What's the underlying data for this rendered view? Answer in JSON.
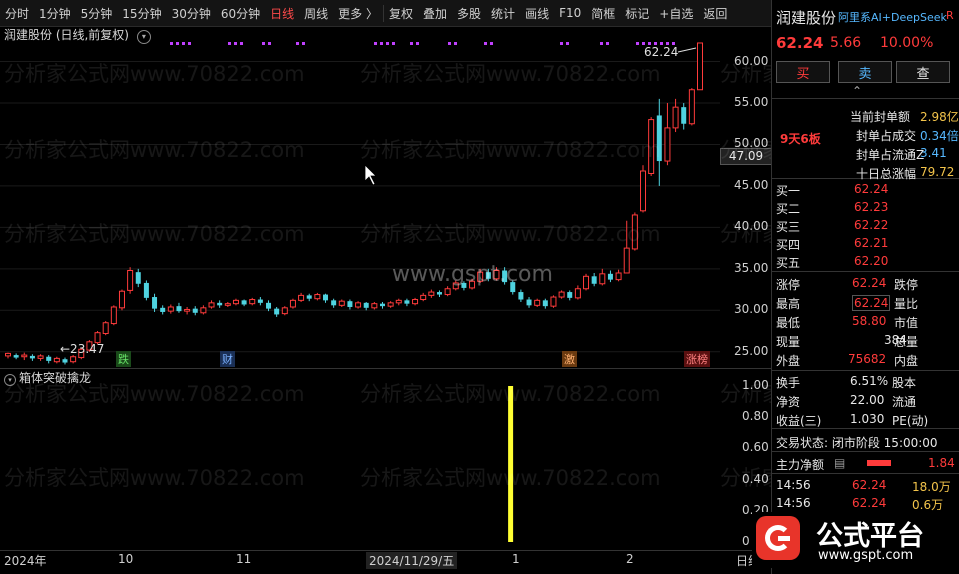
{
  "toolbar": {
    "items": [
      "分时",
      "1分钟",
      "5分钟",
      "15分钟",
      "30分钟",
      "60分钟",
      "日线",
      "周线",
      "更多 〉",
      "复权",
      "叠加",
      "多股",
      "统计",
      "画线",
      "F10",
      "简框",
      "标记",
      "+自选",
      "返回"
    ],
    "active": "日线"
  },
  "chart": {
    "title": "润建股份 (日线,前复权)",
    "watermark": "分析家公式网www.70822.com",
    "center_watermark": "www.gspt.com",
    "price_axis": [
      "60.00",
      "55.00",
      "50.00",
      "45.00",
      "40.00",
      "35.00",
      "30.00",
      "25.00"
    ],
    "current_price_tag": "47.09",
    "high_label": "62.24",
    "low_label": "23.47",
    "event_tags": [
      "跌",
      "财",
      "激",
      "涨榜"
    ],
    "date_axis": [
      "2024年",
      "10",
      "11",
      "2024/11/29/五",
      "1",
      "2",
      "日线"
    ]
  },
  "indicator": {
    "title": "箱体突破擒龙",
    "axis": [
      "1.00",
      "0.80",
      "0.60",
      "0.40",
      "0.20",
      "0"
    ],
    "signal_value": 1.0
  },
  "panel": {
    "name": "润建股份",
    "tags": "阿里系AI+DeepSeek",
    "tag_r": "R",
    "price": "62.24",
    "change": "5.66",
    "change_pct": "10.00%",
    "buttons": [
      "买",
      "卖",
      "查"
    ],
    "streak": "9天6板",
    "seal_info": [
      {
        "label": "当前封单额",
        "value": "2.98亿"
      },
      {
        "label": "封单占成交",
        "value": "0.34倍"
      },
      {
        "label": "封单占流通Z",
        "value": "3.41"
      },
      {
        "label": "十日总涨幅",
        "value": "79.72"
      }
    ],
    "bids": [
      {
        "label": "买一",
        "price": "62.24"
      },
      {
        "label": "买二",
        "price": "62.23"
      },
      {
        "label": "买三",
        "price": "62.22"
      },
      {
        "label": "买四",
        "price": "62.21"
      },
      {
        "label": "买五",
        "price": "62.20"
      }
    ],
    "stats": [
      {
        "l1": "涨停",
        "v1": "62.24",
        "l2": "跌停"
      },
      {
        "l1": "最高",
        "v1": "62.24",
        "l2": "量比"
      },
      {
        "l1": "最低",
        "v1": "58.80",
        "l2": "市值"
      },
      {
        "l1": "现量",
        "v1": "384",
        "l2": "总量"
      },
      {
        "l1": "外盘",
        "v1": "75682",
        "l2": "内盘"
      }
    ],
    "stats2": [
      {
        "l1": "换手",
        "v1": "6.51%",
        "l2": "股本"
      },
      {
        "l1": "净资",
        "v1": "22.00",
        "l2": "流通"
      },
      {
        "l1": "收益(三)",
        "v1": "1.030",
        "l2": "PE(动)"
      }
    ],
    "trade_status": "交易状态: 闭市阶段 15:00:00",
    "main_flow_label": "主力净额",
    "main_flow_value": "1.84",
    "ticks": [
      {
        "time": "14:56",
        "price": "62.24",
        "vol": "18.0万"
      },
      {
        "time": "14:56",
        "price": "62.24",
        "vol": "0.6万"
      }
    ]
  },
  "logo": {
    "title": "公式平台",
    "url": "www.gspt.com"
  },
  "colors": {
    "up": "#ff3b3b",
    "down": "#4fd3e0",
    "signal": "#ffff33",
    "dot": "#c040ff"
  },
  "candles": [
    [
      24.5,
      24.8,
      24.2,
      24.9
    ],
    [
      24.6,
      24.3,
      24.1,
      24.8
    ],
    [
      24.4,
      24.6,
      24.0,
      24.9
    ],
    [
      24.5,
      24.2,
      23.9,
      24.7
    ],
    [
      24.2,
      24.5,
      23.9,
      24.7
    ],
    [
      24.4,
      23.9,
      23.6,
      24.6
    ],
    [
      23.8,
      24.2,
      23.6,
      24.4
    ],
    [
      24.1,
      23.7,
      23.47,
      24.3
    ],
    [
      23.8,
      24.4,
      23.6,
      24.6
    ],
    [
      24.3,
      25.3,
      24.1,
      25.5
    ],
    [
      25.2,
      26.2,
      25.0,
      26.4
    ],
    [
      26.1,
      27.3,
      25.9,
      27.5
    ],
    [
      27.2,
      28.5,
      27.0,
      28.7
    ],
    [
      28.4,
      30.4,
      28.2,
      30.6
    ],
    [
      30.3,
      32.3,
      30.0,
      32.5
    ],
    [
      32.4,
      34.8,
      32.0,
      35.2
    ],
    [
      34.6,
      33.2,
      32.8,
      35.0
    ],
    [
      33.3,
      31.5,
      31.2,
      33.6
    ],
    [
      31.6,
      30.2,
      29.8,
      32.0
    ],
    [
      30.3,
      29.8,
      29.5,
      30.6
    ],
    [
      29.9,
      30.4,
      29.6,
      30.7
    ],
    [
      30.5,
      29.9,
      29.7,
      30.9
    ],
    [
      29.9,
      30.1,
      29.5,
      30.4
    ],
    [
      30.2,
      29.7,
      29.4,
      30.5
    ],
    [
      29.7,
      30.3,
      29.5,
      30.6
    ],
    [
      30.4,
      30.9,
      30.2,
      31.2
    ],
    [
      30.9,
      30.6,
      30.3,
      31.2
    ],
    [
      30.6,
      30.8,
      30.4,
      31.0
    ],
    [
      30.8,
      31.2,
      30.6,
      31.4
    ],
    [
      31.2,
      30.7,
      30.5,
      31.3
    ],
    [
      30.8,
      31.3,
      30.6,
      31.5
    ],
    [
      31.3,
      30.9,
      30.6,
      31.6
    ],
    [
      30.9,
      30.2,
      29.9,
      31.2
    ],
    [
      30.2,
      29.5,
      29.2,
      30.4
    ],
    [
      29.6,
      30.3,
      29.4,
      30.5
    ],
    [
      30.4,
      31.2,
      30.2,
      31.4
    ],
    [
      31.2,
      31.8,
      31.0,
      32.1
    ],
    [
      31.8,
      31.4,
      31.1,
      32.0
    ],
    [
      31.4,
      31.9,
      31.2,
      32.1
    ],
    [
      31.9,
      31.2,
      30.9,
      32.0
    ],
    [
      31.2,
      30.6,
      30.3,
      31.4
    ],
    [
      30.6,
      31.1,
      30.4,
      31.3
    ],
    [
      31.1,
      30.4,
      30.1,
      31.3
    ],
    [
      30.4,
      30.9,
      30.2,
      31.1
    ],
    [
      30.9,
      30.3,
      30.0,
      31.0
    ],
    [
      30.3,
      30.8,
      30.1,
      31.0
    ],
    [
      30.8,
      30.5,
      30.2,
      31.0
    ],
    [
      30.5,
      30.9,
      30.3,
      31.1
    ],
    [
      30.9,
      31.2,
      30.6,
      31.4
    ],
    [
      31.2,
      30.8,
      30.5,
      31.4
    ],
    [
      30.8,
      31.3,
      30.6,
      31.5
    ],
    [
      31.3,
      31.8,
      31.1,
      32.1
    ],
    [
      31.8,
      32.2,
      31.5,
      32.5
    ],
    [
      32.2,
      31.9,
      31.6,
      32.4
    ],
    [
      31.9,
      32.6,
      31.7,
      32.9
    ],
    [
      32.6,
      33.3,
      32.4,
      33.6
    ],
    [
      33.3,
      32.7,
      32.4,
      33.5
    ],
    [
      32.7,
      33.5,
      32.5,
      33.8
    ],
    [
      33.5,
      34.6,
      33.3,
      35.0
    ],
    [
      34.6,
      33.8,
      33.5,
      35.0
    ],
    [
      33.8,
      34.8,
      33.6,
      35.2
    ],
    [
      34.8,
      33.4,
      33.1,
      35.2
    ],
    [
      33.4,
      32.2,
      31.9,
      33.6
    ],
    [
      32.2,
      31.3,
      31.0,
      32.5
    ],
    [
      31.3,
      30.6,
      30.3,
      31.6
    ],
    [
      30.6,
      31.2,
      30.4,
      31.4
    ],
    [
      31.2,
      30.5,
      30.2,
      31.4
    ],
    [
      30.5,
      31.6,
      30.3,
      31.8
    ],
    [
      31.6,
      32.2,
      31.4,
      32.4
    ],
    [
      32.2,
      31.5,
      31.2,
      32.4
    ],
    [
      31.5,
      32.6,
      31.3,
      33.0
    ],
    [
      32.6,
      34.1,
      32.4,
      34.4
    ],
    [
      34.1,
      33.2,
      32.9,
      34.5
    ],
    [
      33.2,
      34.4,
      33.0,
      35.0
    ],
    [
      34.4,
      33.7,
      33.4,
      34.8
    ],
    [
      33.7,
      34.5,
      33.5,
      34.9
    ],
    [
      34.5,
      37.5,
      37.1,
      40.8
    ],
    [
      37.4,
      41.5,
      37.2,
      41.8
    ],
    [
      42.0,
      46.8,
      41.8,
      47.5
    ],
    [
      46.5,
      53.0,
      46.2,
      53.3
    ],
    [
      53.5,
      48.0,
      45.0,
      55.5
    ],
    [
      48.0,
      52.0,
      47.5,
      55.0
    ],
    [
      52.0,
      54.5,
      51.5,
      55.5
    ],
    [
      54.5,
      52.5,
      51.8,
      55.0
    ],
    [
      52.5,
      56.6,
      52.3,
      56.8
    ],
    [
      56.6,
      62.24,
      56.6,
      62.24
    ]
  ],
  "signal_index": 61
}
